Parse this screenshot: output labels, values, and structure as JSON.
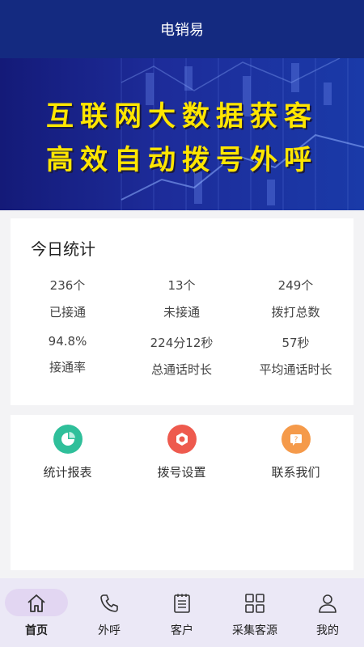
{
  "header": {
    "title": "电销易"
  },
  "banner": {
    "line1": "互联网大数据获客",
    "line2": "高效自动拨号外呼"
  },
  "stats": {
    "title": "今日统计",
    "items": [
      {
        "value": "236个",
        "label": "已接通"
      },
      {
        "value": "13个",
        "label": "未接通"
      },
      {
        "value": "249个",
        "label": "拨打总数"
      },
      {
        "value": "94.8%",
        "label": "接通率"
      },
      {
        "value": "224分12秒",
        "label": "总通话时长"
      },
      {
        "value": "57秒",
        "label": "平均通话时长"
      }
    ]
  },
  "menu": {
    "items": [
      {
        "label": "统计报表",
        "icon": "pie-chart-icon",
        "color": "#2fbf9a"
      },
      {
        "label": "拨号设置",
        "icon": "settings-icon",
        "color": "#ee5a4e"
      },
      {
        "label": "联系我们",
        "icon": "contact-icon",
        "color": "#f59a4a"
      }
    ]
  },
  "tabbar": {
    "items": [
      {
        "label": "首页",
        "icon": "home-icon"
      },
      {
        "label": "外呼",
        "icon": "phone-icon"
      },
      {
        "label": "客户",
        "icon": "clipboard-icon"
      },
      {
        "label": "采集客源",
        "icon": "grid-icon"
      },
      {
        "label": "我的",
        "icon": "user-icon"
      }
    ],
    "active": "首页"
  }
}
